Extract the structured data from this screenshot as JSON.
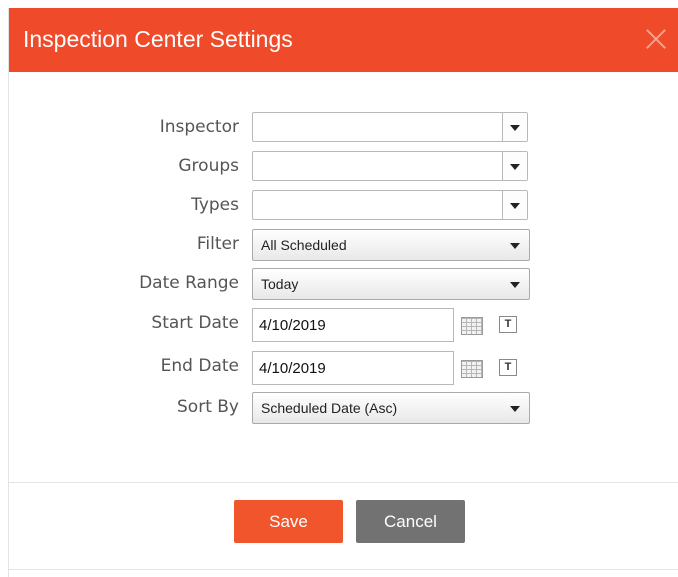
{
  "dialog": {
    "title": "Inspection Center Settings",
    "close_icon": "close-icon"
  },
  "fields": {
    "inspector": {
      "label": "Inspector",
      "value": ""
    },
    "groups": {
      "label": "Groups",
      "value": ""
    },
    "types": {
      "label": "Types",
      "value": ""
    },
    "filter": {
      "label": "Filter",
      "value": "All Scheduled"
    },
    "date_range": {
      "label": "Date Range",
      "value": "Today"
    },
    "start_date": {
      "label": "Start Date",
      "value": "4/10/2019"
    },
    "end_date": {
      "label": "End Date",
      "value": "4/10/2019"
    },
    "sort_by": {
      "label": "Sort By",
      "value": "Scheduled Date (Asc)"
    }
  },
  "buttons": {
    "save": "Save",
    "cancel": "Cancel",
    "today_glyph": "T"
  },
  "colors": {
    "header": "#ef4a2a",
    "save": "#f0552c",
    "cancel": "#727272"
  }
}
